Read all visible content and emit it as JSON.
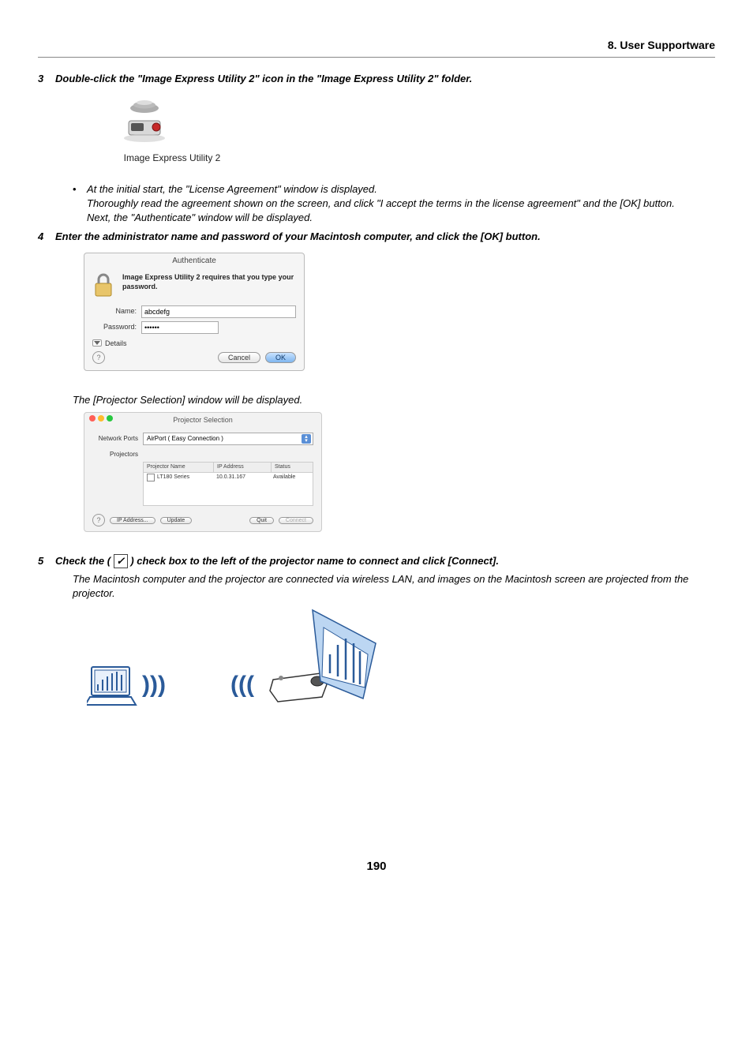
{
  "header": {
    "section": "8. User Supportware"
  },
  "step3": {
    "num": "3",
    "text": "Double-click the \"Image Express Utility 2\" icon in the \"Image Express Utility 2\" folder.",
    "icon_caption": "Image Express Utility 2",
    "bullet1": "At the initial start, the \"License Agreement\" window is displayed.",
    "body1": "Thoroughly read the agreement shown on the screen, and click \"I accept the terms in the license agreement\" and the [OK] button.",
    "body2": "Next, the \"Authenticate\" window will be displayed."
  },
  "step4": {
    "num": "4",
    "text": "Enter the administrator name and password of your Macintosh computer, and click the [OK] button.",
    "auth": {
      "title": "Authenticate",
      "message": "Image Express Utility 2 requires that you type your password.",
      "name_label": "Name:",
      "name_value": "abcdefg",
      "pass_label": "Password:",
      "pass_value": "••••••",
      "details": "Details",
      "cancel": "Cancel",
      "ok": "OK"
    },
    "after_text": "The [Projector Selection] window will be displayed.",
    "proj": {
      "title": "Projector Selection",
      "ports_label": "Network Ports",
      "ports_value": "AirPort ( Easy Connection )",
      "list_label": "Projectors",
      "col1": "Projector Name",
      "col2": "IP Address",
      "col3": "Status",
      "row_name": "LT180 Series",
      "row_ip": "10.0.31.167",
      "row_status": "Available",
      "btn_ip": "IP Address...",
      "btn_update": "Update",
      "btn_quit": "Quit",
      "btn_connect": "Connect"
    }
  },
  "step5": {
    "num": "5",
    "pre": "Check the (",
    "post": ") check box to the left of the projector name to connect and click [Connect].",
    "body": "The Macintosh computer and the projector are connected via wireless LAN, and images on the Macintosh screen are projected from the projector."
  },
  "page_number": "190"
}
